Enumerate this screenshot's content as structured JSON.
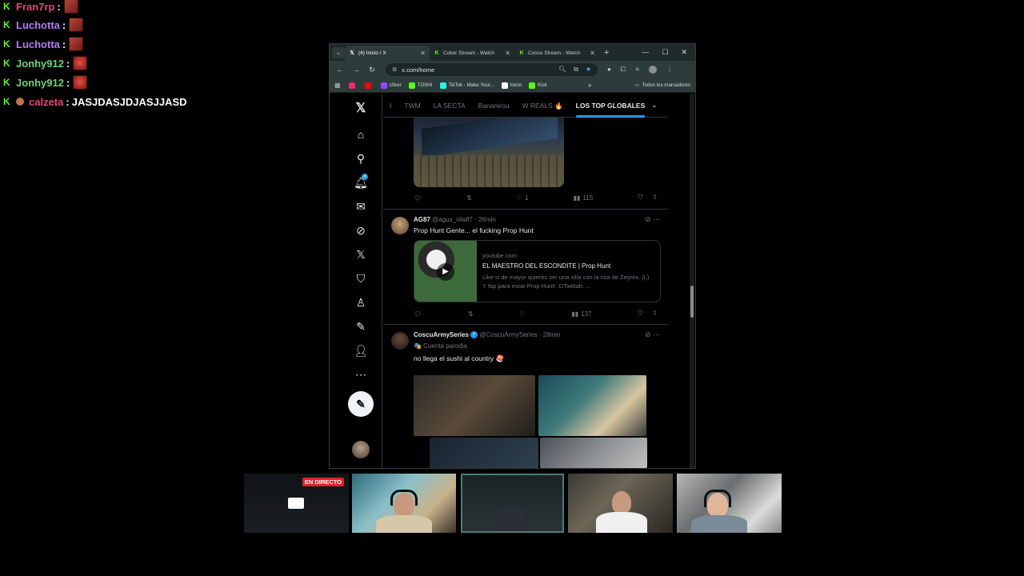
{
  "chat": {
    "messages": [
      {
        "user": "Fran7rp",
        "color": "#e0487a",
        "sep": ":",
        "text": ""
      },
      {
        "user": "Luchotta",
        "color": "#b57cf2",
        "sep": ":",
        "text": ""
      },
      {
        "user": "Luchotta",
        "color": "#b57cf2",
        "sep": ":",
        "text": ""
      },
      {
        "user": "Jonhy912",
        "color": "#6dd37a",
        "sep": ":",
        "text": ""
      },
      {
        "user": "Jonhy912",
        "color": "#6dd37a",
        "sep": ":",
        "text": ""
      },
      {
        "user": "calzeta",
        "color": "#e0487a",
        "sep": ":",
        "text": "JASJDASJDJASJJASD"
      }
    ]
  },
  "browser": {
    "tabs": [
      {
        "title": "(4) Inicio / X",
        "icon": "x-logo-icon",
        "active": true
      },
      {
        "title": "Coker Stream - Watch",
        "icon": "kick-icon",
        "active": false
      },
      {
        "title": "Coscu Stream - Watch",
        "icon": "kick-icon",
        "active": false
      }
    ],
    "url": "x.com/home",
    "bookmarks": [
      {
        "label": "",
        "color": "#e1306c",
        "icon": "instagram-icon"
      },
      {
        "label": "",
        "color": "#ff0000",
        "icon": "youtube-icon"
      },
      {
        "label": "c0ker",
        "color": "#9146ff",
        "icon": "twitch-icon"
      },
      {
        "label": "TOSHI",
        "color": "#53fc18",
        "icon": "kick-icon"
      },
      {
        "label": "TikTok - Make Your...",
        "color": "#25f4ee",
        "icon": "tiktok-icon"
      },
      {
        "label": "Inicio",
        "color": "#ffffff",
        "icon": "x-logo-icon"
      },
      {
        "label": "Kick",
        "color": "#53fc18",
        "icon": "kick-icon"
      }
    ],
    "all_bookmarks": "Todos los marcadores"
  },
  "x": {
    "topics": [
      "I",
      "TWM",
      "LA SECTA",
      "Bananirou",
      "W REALS 🔥",
      "LOS TOP GLOBALES"
    ],
    "active_topic_index": 5,
    "tweet1": {
      "likes": "1",
      "views": "115"
    },
    "tweet2": {
      "name": "AG87",
      "handle": "@agus_vila87 · 26min",
      "text": "Prop Hunt Gente... el fucking Prop Hunt",
      "card": {
        "domain": "youtube.com",
        "title": "EL MAESTRO DEL ESCONDITE | Prop Hunt",
        "desc": "Like si de mayor quieres ser una silla con la risa de Zeyrex. (L) Y fap para moar Prop Hunt! :DTwittah: ..."
      },
      "views": "137"
    },
    "tweet3": {
      "name": "CoscuArmySeries",
      "handle": "@CoscuArmySeries · 28min",
      "label": "🎭 Cuenta parodia",
      "text": "no llega el sushi al country 🍣"
    },
    "notif_count": "4"
  },
  "cams": {
    "live_label": "EN DIRECTO"
  },
  "colors": {
    "x_blue": "#1d9bf0",
    "kick_green": "#53fc18",
    "live_red": "#e0202a"
  }
}
